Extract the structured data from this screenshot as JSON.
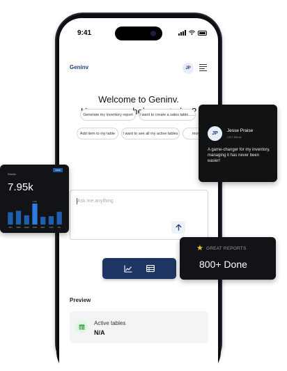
{
  "status_bar": {
    "time": "9:41"
  },
  "app": {
    "brand": "Geninv",
    "user_initials": "JP"
  },
  "welcome": {
    "line1": "Welcome to Geninv.",
    "line2": "How can we help you today?"
  },
  "suggestions": [
    "Generate my inventory report",
    "I want to create a sales table......",
    "Add item to my table",
    "I want to see all my active tables",
    "more"
  ],
  "ask": {
    "placeholder": "Ask me anything"
  },
  "preview": {
    "label": "Preview",
    "card_title": "Active tables",
    "card_value": "N/A"
  },
  "testimonial": {
    "initials": "JP",
    "name": "Jesse Praise",
    "role": "CEO Billrall",
    "quote": "A game-changer for my inventory, managing it has never been easier!"
  },
  "stats_card": {
    "title": "Stocks",
    "badge": "VIEW",
    "value": "7.95k"
  },
  "chart_data": {
    "type": "bar",
    "title": "Stocks",
    "categories": [
      "JAN",
      "FEB",
      "MAR",
      "APR",
      "MAY",
      "JUN",
      "JUL"
    ],
    "values": [
      4.1,
      4.6,
      3.1,
      7.0,
      2.6,
      2.8,
      4.3
    ],
    "data_labels": {
      "APR": "7.0K"
    },
    "highlighted": "APR",
    "colors": {
      "bar": "#1e5fb0",
      "highlight": "#2f7be0"
    }
  },
  "reports": {
    "label": "GREAT REPORTS",
    "value": "800+ Done"
  },
  "icons": {
    "menu": "hamburger-menu-icon",
    "send": "arrow-up-icon",
    "chart": "line-chart-icon",
    "table": "table-icon",
    "preview": "spreadsheet-icon",
    "star": "star-icon"
  },
  "colors": {
    "brand": "#1d3d7a",
    "toolbar": "#1e3563",
    "card_dark": "#121316",
    "star": "#f2c230"
  }
}
